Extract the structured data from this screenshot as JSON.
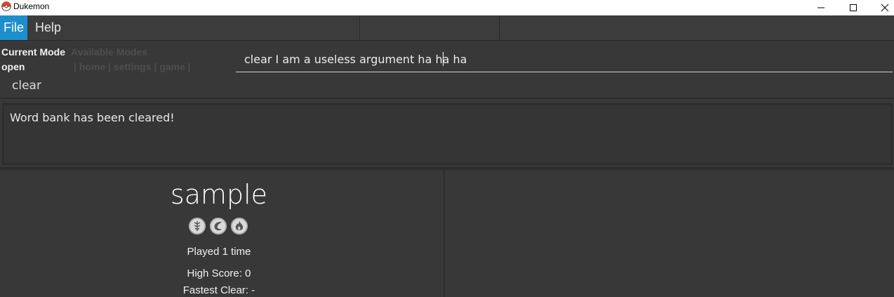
{
  "window": {
    "title": "Dukemon",
    "icon": "pokeball-icon",
    "controls": [
      "minimize-icon",
      "maximize-icon",
      "close-icon"
    ]
  },
  "menu": {
    "file_label": "File",
    "help_label": "Help"
  },
  "mode": {
    "current_label": "Current Mode",
    "current_value": "open",
    "available_label": "Available Modes",
    "available_list": "| home | settings | game |"
  },
  "command": {
    "value": "clear I am a useless argument ha ha ha"
  },
  "echo": {
    "text": "clear"
  },
  "result": {
    "text": "Word bank has been cleared!"
  },
  "card": {
    "title": "sample",
    "badge_icons": [
      "grass-type-icon",
      "water-type-icon",
      "fire-type-icon"
    ],
    "played": "Played 1 time",
    "high_score": "High Score: 0",
    "fastest_clear": "Fastest Clear:  -"
  },
  "colors": {
    "accent": "#1d8fcf",
    "background": "#383838",
    "muted_text": "#4e4e4e"
  }
}
